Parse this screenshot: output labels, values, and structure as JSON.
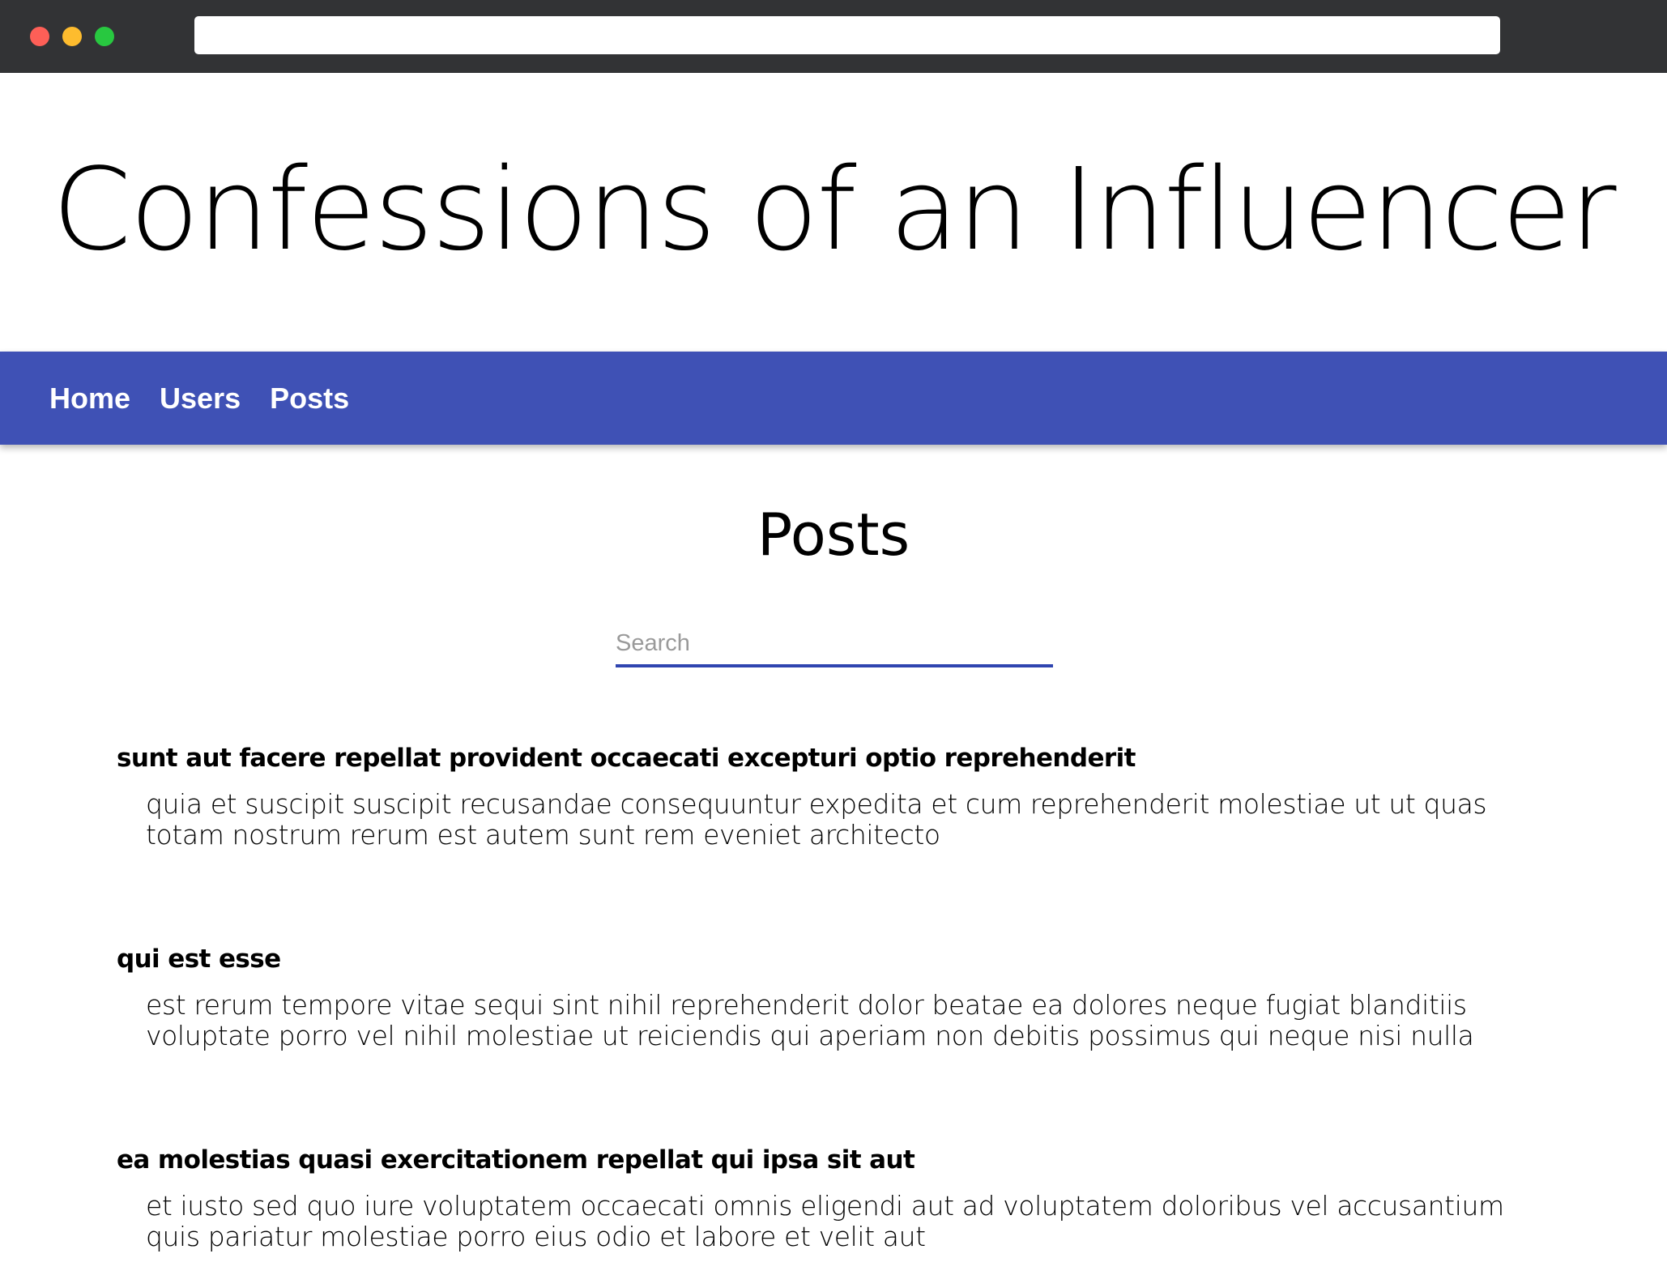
{
  "browser": {
    "address_value": "",
    "colors": {
      "chrome": "#323335",
      "close": "#fe5f57",
      "minimize": "#febc2e",
      "zoom": "#28c840"
    }
  },
  "site": {
    "title": "Confessions of an Influencer"
  },
  "nav": {
    "background": "#3f51b5",
    "links": [
      {
        "label": "Home"
      },
      {
        "label": "Users"
      },
      {
        "label": "Posts"
      }
    ]
  },
  "page": {
    "heading": "Posts"
  },
  "search": {
    "placeholder": "Search",
    "value": "",
    "underline_color": "#2f45b0"
  },
  "posts": [
    {
      "title": "sunt aut facere repellat provident occaecati excepturi optio reprehenderit",
      "body": "quia et suscipit suscipit recusandae consequuntur expedita et cum reprehenderit molestiae ut ut quas totam nostrum rerum est autem sunt rem eveniet architecto"
    },
    {
      "title": "qui est esse",
      "body": "est rerum tempore vitae sequi sint nihil reprehenderit dolor beatae ea dolores neque fugiat blanditiis voluptate porro vel nihil molestiae ut reiciendis qui aperiam non debitis possimus qui neque nisi nulla"
    },
    {
      "title": "ea molestias quasi exercitationem repellat qui ipsa sit aut",
      "body": "et iusto sed quo iure voluptatem occaecati omnis eligendi aut ad voluptatem doloribus vel accusantium quis pariatur molestiae porro eius odio et labore et velit aut"
    }
  ]
}
